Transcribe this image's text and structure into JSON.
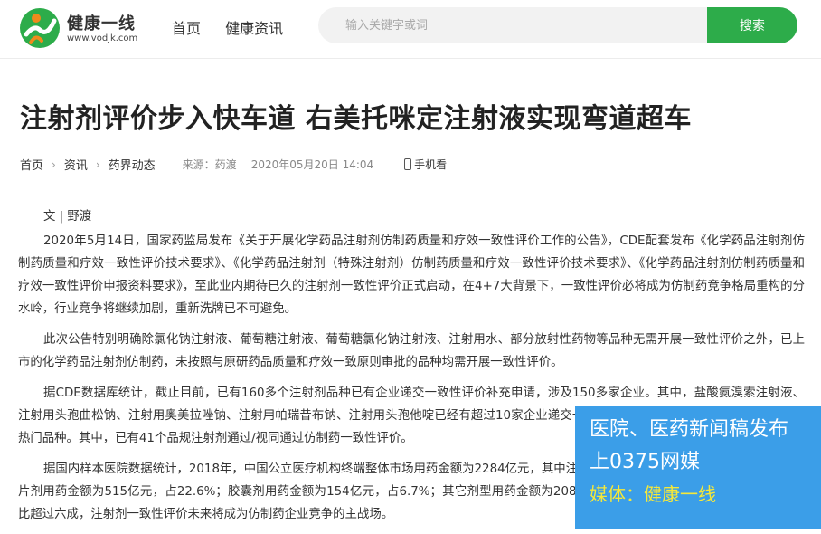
{
  "header": {
    "logo_name": "健康一线",
    "logo_url": "www.vodjk.com",
    "nav": [
      "首页",
      "健康资讯"
    ],
    "search_placeholder": "输入关键字或词",
    "search_button": "搜索"
  },
  "article": {
    "title": "注射剂评价步入快车道 右美托咪定注射液实现弯道超车",
    "breadcrumb": [
      "首页",
      "资讯",
      "药界动态"
    ],
    "source": "来源：药渡",
    "date": "2020年05月20日 14:04",
    "mobile_label": "手机看",
    "author": "文 | 野渡",
    "paragraphs": [
      "2020年5月14日，国家药监局发布《关于开展化学药品注射剂仿制药质量和疗效一致性评价工作的公告》，CDE配套发布《化学药品注射剂仿制药质量和疗效一致性评价技术要求》、《化学药品注射剂（特殊注射剂）仿制药质量和疗效一致性评价技术要求》、《化学药品注射剂仿制药质量和疗效一致性评价申报资料要求》，至此业内期待已久的注射剂一致性评价正式启动，在4+7大背景下，一致性评价必将成为仿制药竞争格局重构的分水岭，行业竞争将继续加剧，重新洗牌已不可避免。",
      "此次公告特别明确除氯化钠注射液、葡萄糖注射液、葡萄糖氯化钠注射液、注射用水、部分放射性药物等品种无需开展一致性评价之外，已上市的化学药品注射剂仿制药，未按照与原研药品质量和疗效一致原则审批的品种均需开展一致性评价。",
      "据CDE数据库统计，截止目前，已有160多个注射剂品种已有企业递交一致性评价补充申请，涉及150多家企业。其中，盐酸氨溴索注射液、注射用头孢曲松钠、注射用奥美拉唑钠、注射用帕瑞昔布钠、注射用头孢他啶已经有超过10家企业递交一致性评价补充申请，是注射剂里面的最为热门品种。其中，已有41个品规注射剂通过/视同通过仿制药一致性评价。",
      "据国内样本医院数据统计，2018年，中国公立医疗机构终端整体市场用药金额为2284亿元，其中注射剂用药金额为1407亿元，占比61.6%；片剂用药金额为515亿元，占22.6%；胶囊剂用药金额为154亿元，占6.7%；其它剂型用药金额为208亿元，占9.1%。注射剂在我国样本医院占比超过六成，注射剂一致性评价未来将成为仿制药企业竞争的主战场。"
    ]
  },
  "ad": {
    "line1": "医院、医药新闻稿发布",
    "line2": "上0375网媒",
    "line3": "媒体：健康一线"
  },
  "colors": {
    "brand_green": "#2dac4a",
    "logo_orange": "#f08a1c",
    "ad_blue": "#3b9ee8",
    "ad_yellow": "#f5e83a"
  }
}
